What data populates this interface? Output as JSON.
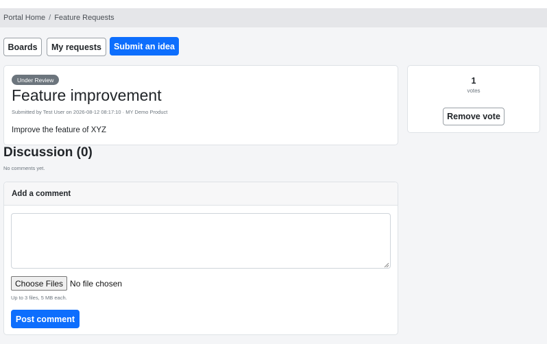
{
  "breadcrumb": {
    "home": "Portal Home",
    "separator": "/",
    "current": "Feature Requests"
  },
  "nav": {
    "boards": "Boards",
    "my_requests": "My requests",
    "submit": "Submit an idea"
  },
  "request": {
    "status": "Under Review",
    "title": "Feature improvement",
    "meta": "Submitted by Test User on 2026-08-12 08:17:10 · MY Demo Product",
    "description": "Improve the feature of XYZ"
  },
  "votes": {
    "count": "1",
    "label": "votes",
    "remove_label": "Remove vote"
  },
  "discussion": {
    "heading": "Discussion (0)",
    "empty": "No comments yet."
  },
  "comment_form": {
    "header": "Add a comment",
    "textarea_value": "",
    "file_button": "Choose Files",
    "file_status": "No file chosen",
    "file_hint": "Up to 3 files, 5 MB each.",
    "submit_label": "Post comment"
  },
  "colors": {
    "primary": "#0d6efd",
    "badge": "#6c757d",
    "muted": "#6c757d"
  }
}
